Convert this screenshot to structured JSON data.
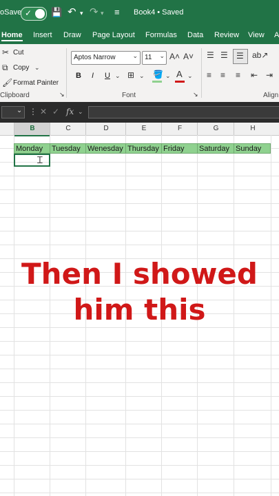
{
  "titlebar": {
    "autosave_label": "oSave",
    "toggle_check": "✓",
    "doc_title": "Book4 • Saved",
    "save_icon": "💾",
    "undo_icon": "↶",
    "redo_icon": "↷",
    "more_icon": "≡"
  },
  "tabs": [
    "Home",
    "Insert",
    "Draw",
    "Page Layout",
    "Formulas",
    "Data",
    "Review",
    "View",
    "A"
  ],
  "ribbon": {
    "clipboard": {
      "cut": "Cut",
      "copy": "Copy",
      "format_painter": "Format Painter",
      "group_label": "Clipboard"
    },
    "font": {
      "font_name": "Aptos Narrow",
      "font_size": "11",
      "grow": "A˄",
      "shrink": "A˅",
      "bold": "B",
      "italic": "I",
      "underline": "U",
      "group_label": "Font"
    },
    "alignment": {
      "group_label": "Align"
    }
  },
  "formula_bar": {
    "fx": "fx",
    "cancel": "✕",
    "enter": "✓"
  },
  "columns": [
    "B",
    "C",
    "D",
    "E",
    "F",
    "G",
    "H"
  ],
  "days": [
    "Monday",
    "Tuesday",
    "Wenesday",
    "Thursday",
    "Friday",
    "Saturday",
    "Sunday"
  ],
  "caption": {
    "line1": "Then I showed",
    "line2": "him this"
  },
  "colors": {
    "excel_green": "#217346",
    "cell_fill": "#8fd18f",
    "caption_red": "#d01818"
  }
}
